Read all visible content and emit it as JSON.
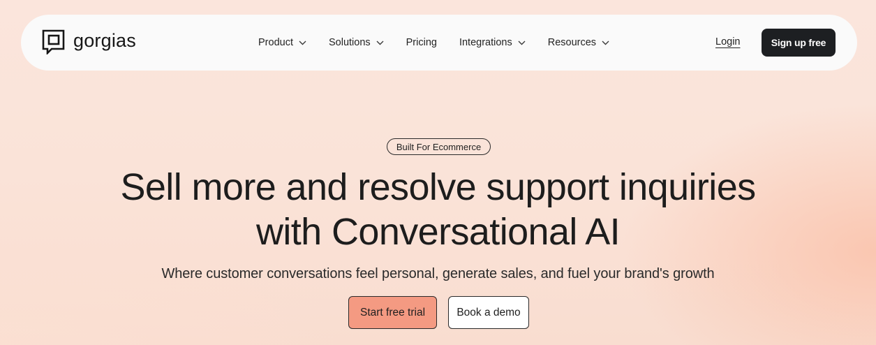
{
  "header": {
    "logo_text": "gorgias",
    "logo_icon": "gorgias-logo-icon",
    "nav": [
      {
        "label": "Product",
        "has_dropdown": true,
        "icon": "chevron-down-icon"
      },
      {
        "label": "Solutions",
        "has_dropdown": true,
        "icon": "chevron-down-icon"
      },
      {
        "label": "Pricing",
        "has_dropdown": false
      },
      {
        "label": "Integrations",
        "has_dropdown": true,
        "icon": "chevron-down-icon"
      },
      {
        "label": "Resources",
        "has_dropdown": true,
        "icon": "chevron-down-icon"
      }
    ],
    "login_label": "Login",
    "signup_label": "Sign up free"
  },
  "hero": {
    "badge": "Built For Ecommerce",
    "headline_line1": "Sell more and resolve support inquiries",
    "headline_line2": "with Conversational AI",
    "subtitle": "Where customer conversations feel personal, generate sales, and fuel your brand's growth",
    "primary_cta": "Start free trial",
    "secondary_cta": "Book a demo"
  },
  "colors": {
    "background": "#fae3d8",
    "navbar_background": "#fafafa",
    "signup_button": "#1d1f22",
    "primary_cta": "#f49a82",
    "secondary_cta": "#ffffff",
    "text": "#1f1f1f"
  }
}
